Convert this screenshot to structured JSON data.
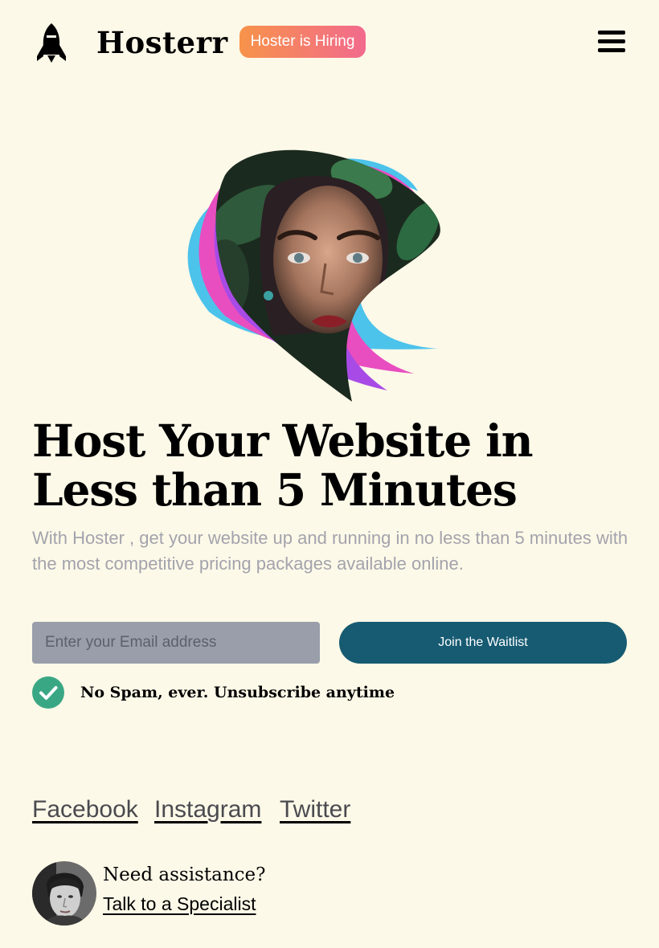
{
  "header": {
    "brand": "Hosterr",
    "hiring_badge": "Hoster is Hiring",
    "logo_icon": "rocket-icon",
    "menu_icon": "hamburger-menu-icon"
  },
  "hero": {
    "headline": "Host Your Website in Less than 5 Minutes",
    "subtext": "With Hoster , get your website up and running in no less than 5 minutes with the most competitive pricing packages available online."
  },
  "form": {
    "email_placeholder": "Enter your Email address",
    "join_label": "Join the Waitlist",
    "nospam_text": "No Spam, ever. Unsubscribe anytime",
    "check_icon": "check-circle-icon"
  },
  "social": {
    "facebook": "Facebook",
    "instagram": "Instagram",
    "twitter": "Twitter"
  },
  "assistance": {
    "question": "Need assistance?",
    "link": "Talk to a Specialist"
  },
  "colors": {
    "background": "#fdf9e8",
    "badge_gradient_start": "#f7934a",
    "badge_gradient_end": "#f26a8d",
    "join_button": "#165b72",
    "check_green": "#3aa784",
    "subtext": "#a3a3ad",
    "input_bg": "#999eaa",
    "blob_blue": "#4cc3eb",
    "blob_pink": "#e84ec0",
    "blob_purple": "#a84be6"
  }
}
